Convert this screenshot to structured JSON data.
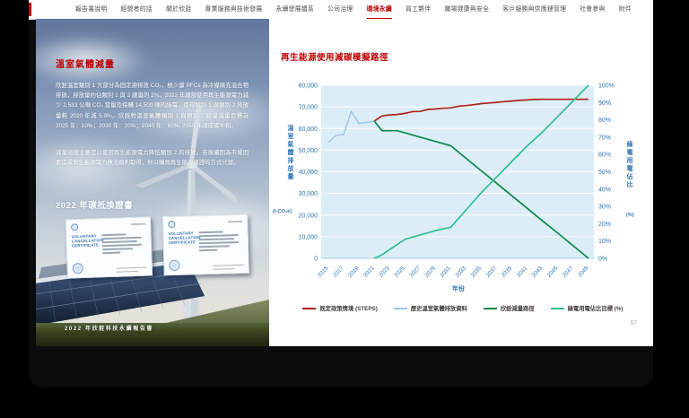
{
  "navbar": {
    "accent_color": "#c00000",
    "items": [
      {
        "label": "報告書說明",
        "active": false
      },
      {
        "label": "經營者的話",
        "active": false
      },
      {
        "label": "關於欣銓",
        "active": false
      },
      {
        "label": "專業服務與技術發展",
        "active": false
      },
      {
        "label": "永續發展體系",
        "active": false
      },
      {
        "label": "公司治理",
        "active": false
      },
      {
        "label": "環境永續",
        "active": true
      },
      {
        "label": "員工夥伴",
        "active": false
      },
      {
        "label": "職場健康與安全",
        "active": false
      },
      {
        "label": "客戶服務與供應鏈管理",
        "active": false
      },
      {
        "label": "社會參與",
        "active": false
      },
      {
        "label": "附件",
        "active": false
      }
    ]
  },
  "left_page": {
    "title": "溫室氣體減量",
    "paragraph1": "欣銓溫室類別 1 大部分為固定源排放 CO₂，極少量 PFCs 為冷媒填充混合物排放，排放量約佔類別 1 與 2 總量的 2%。2022 年總部使用再生能源電力減少 2,533 公噸 CO₂ 當量及採購 14,500 噸的綠電，使得類別 1 與類別 2 排放量較 2020 年減 5.9%。欣銓對溫室氣體類別 1 與類別 2 總量減量目標為 2025 年：10%；2030 年：20%；2040 年：60%; 2050 年達成碳中和。",
    "paragraph2": "減量途徑主要是以使用再生能源電力降低類別 2 的排放。若後續因為市場因素造成再生能源電力無法順利取得，則以購買再生能源憑證的方式代替。",
    "section_header": "2022 年碳抵換證書",
    "certificate_title": "VOLUNTARY CANCELLATION CERTIFICATE",
    "footer_caption": "2022 年欣銓科技永續報告書"
  },
  "right_page": {
    "page_number": "57"
  },
  "chart_data": {
    "type": "line",
    "title": "再生能源使用減碳模擬路徑",
    "xlabel": "年份",
    "ylabel_left": "溫室氣體排放量",
    "ylabel_left_unit": "(t-CO₂e)",
    "ylabel_right": "綠電用電佔比",
    "ylabel_right_unit": "(%)",
    "x_ticks": [
      2015,
      2017,
      2019,
      2021,
      2023,
      2025,
      2027,
      2029,
      2031,
      2033,
      2035,
      2037,
      2039,
      2041,
      2043,
      2045,
      2047,
      2049
    ],
    "xlim": [
      2015,
      2049
    ],
    "ylim_left": [
      0,
      80000
    ],
    "ytick_step_left": 10000,
    "ylim_right": [
      0,
      100
    ],
    "ytick_step_right": 10,
    "plot_background": "#dcedf8",
    "grid_color": "#ffffff",
    "axis_text_color": "#2e74b5",
    "legend_position": "bottom",
    "series": [
      {
        "name": "既定政策情境 (STEPS)",
        "color": "#b02418",
        "axis": "left",
        "points": [
          [
            2021,
            63400
          ],
          [
            2022,
            65800
          ],
          [
            2023,
            66300
          ],
          [
            2024,
            66500
          ],
          [
            2025,
            67000
          ],
          [
            2026,
            67800
          ],
          [
            2027,
            67900
          ],
          [
            2028,
            68800
          ],
          [
            2029,
            69000
          ],
          [
            2030,
            69400
          ],
          [
            2031,
            69500
          ],
          [
            2032,
            70300
          ],
          [
            2033,
            70600
          ],
          [
            2034,
            71000
          ],
          [
            2035,
            71500
          ],
          [
            2036,
            71800
          ],
          [
            2037,
            72100
          ],
          [
            2038,
            72400
          ],
          [
            2039,
            72700
          ],
          [
            2040,
            73000
          ],
          [
            2041,
            73200
          ],
          [
            2042,
            73400
          ],
          [
            2043,
            73500
          ],
          [
            2045,
            73500
          ],
          [
            2047,
            73500
          ],
          [
            2049,
            73500
          ]
        ]
      },
      {
        "name": "歷史溫室氣體排放資料",
        "color": "#9dc3e6",
        "axis": "left",
        "points": [
          [
            2015,
            53500
          ],
          [
            2016,
            56800
          ],
          [
            2017,
            57200
          ],
          [
            2018,
            68000
          ],
          [
            2019,
            62300
          ],
          [
            2020,
            62800
          ],
          [
            2021,
            63400
          ]
        ]
      },
      {
        "name": "欣銓減量路徑",
        "color": "#0b8a44",
        "axis": "left",
        "points": [
          [
            2021,
            63400
          ],
          [
            2022,
            59000
          ],
          [
            2023,
            59000
          ],
          [
            2024,
            59000
          ],
          [
            2025,
            58000
          ],
          [
            2027,
            56000
          ],
          [
            2029,
            54000
          ],
          [
            2031,
            52000
          ],
          [
            2033,
            46200
          ],
          [
            2035,
            40400
          ],
          [
            2037,
            34700
          ],
          [
            2039,
            28900
          ],
          [
            2041,
            23100
          ],
          [
            2043,
            17300
          ],
          [
            2045,
            11600
          ],
          [
            2047,
            5800
          ],
          [
            2049,
            0
          ]
        ]
      },
      {
        "name": "綠電用電佔比目標 (%)",
        "color": "#2fbe8f",
        "axis": "right",
        "points": [
          [
            2021,
            0
          ],
          [
            2022,
            2
          ],
          [
            2023,
            5
          ],
          [
            2024,
            8
          ],
          [
            2025,
            11
          ],
          [
            2027,
            13.5
          ],
          [
            2029,
            16
          ],
          [
            2031,
            18
          ],
          [
            2033,
            28
          ],
          [
            2035,
            38
          ],
          [
            2037,
            47
          ],
          [
            2039,
            56
          ],
          [
            2041,
            65
          ],
          [
            2043,
            73
          ],
          [
            2045,
            82
          ],
          [
            2047,
            91
          ],
          [
            2049,
            100
          ]
        ]
      }
    ]
  }
}
